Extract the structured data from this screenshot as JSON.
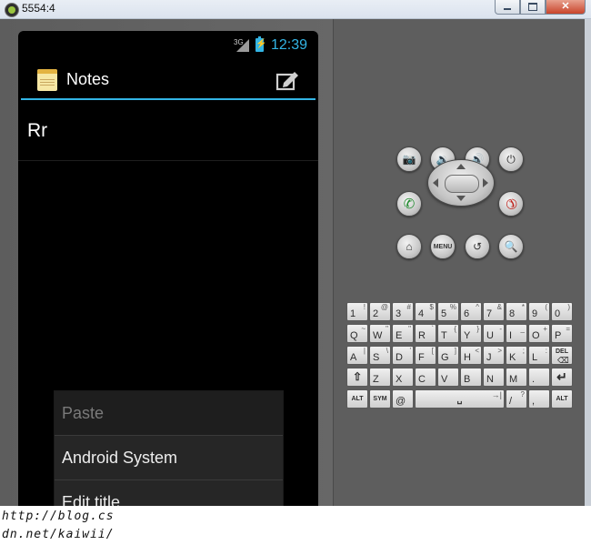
{
  "window": {
    "title": "5554:4"
  },
  "status_bar": {
    "network": "3G",
    "time": "12:39"
  },
  "app": {
    "title": "Notes",
    "compose_icon": "compose-icon",
    "notes_icon": "notepad-icon"
  },
  "notes_list": [
    {
      "title": "Rr"
    }
  ],
  "context_menu": {
    "items": [
      {
        "label": "Paste",
        "enabled": false
      },
      {
        "label": "Android System",
        "enabled": true
      },
      {
        "label": "Edit title",
        "enabled": true
      }
    ]
  },
  "hardware_buttons": {
    "row1": [
      "camera-icon",
      "volume-down-icon",
      "volume-up-icon",
      "power-icon"
    ],
    "row2": [
      "call-icon",
      "dpad",
      "end-call-icon"
    ],
    "row3": [
      "home-icon",
      "MENU",
      "back-icon",
      "search-icon"
    ]
  },
  "keyboard": {
    "row1": [
      [
        "1",
        "!"
      ],
      [
        "2",
        "@"
      ],
      [
        "3",
        "#"
      ],
      [
        "4",
        "$"
      ],
      [
        "5",
        "%"
      ],
      [
        "6",
        "^"
      ],
      [
        "7",
        "&"
      ],
      [
        "8",
        "*"
      ],
      [
        "9",
        "("
      ],
      [
        "0",
        ")"
      ]
    ],
    "row2": [
      [
        "Q",
        "~"
      ],
      [
        "W",
        "\""
      ],
      [
        "E",
        "\""
      ],
      [
        "R",
        "`"
      ],
      [
        "T",
        "{"
      ],
      [
        "Y",
        "}"
      ],
      [
        "U",
        "-"
      ],
      [
        "I",
        "_"
      ],
      [
        "O",
        "+"
      ],
      [
        "P",
        "="
      ]
    ],
    "row3": [
      [
        "A",
        "|"
      ],
      [
        "S",
        "\\"
      ],
      [
        "D",
        "'"
      ],
      [
        "F",
        "["
      ],
      [
        "G",
        "]"
      ],
      [
        "H",
        "<"
      ],
      [
        "J",
        ">"
      ],
      [
        "K",
        ";"
      ],
      [
        "L",
        ":"
      ],
      [
        "DEL",
        ""
      ]
    ],
    "row4": [
      [
        "⇧",
        ""
      ],
      [
        "Z",
        ""
      ],
      [
        "X",
        ""
      ],
      [
        "C",
        ""
      ],
      [
        "V",
        ""
      ],
      [
        "B",
        ""
      ],
      [
        "N",
        ""
      ],
      [
        "M",
        ""
      ],
      [
        ".",
        ""
      ],
      [
        "↵",
        ""
      ]
    ],
    "row5": [
      [
        "ALT",
        ""
      ],
      [
        "SYM",
        ""
      ],
      [
        "@",
        ""
      ],
      [
        "␣",
        "→|"
      ],
      [
        "/",
        "?"
      ],
      [
        ",",
        ""
      ],
      [
        "ALT",
        ""
      ]
    ]
  },
  "watermark": {
    "line1": "http://blog.cs",
    "line2": "dn.net/kaiwii/"
  },
  "colors": {
    "accent": "#33b5e5",
    "screen_bg": "#000000",
    "menu_bg": "#262626"
  }
}
